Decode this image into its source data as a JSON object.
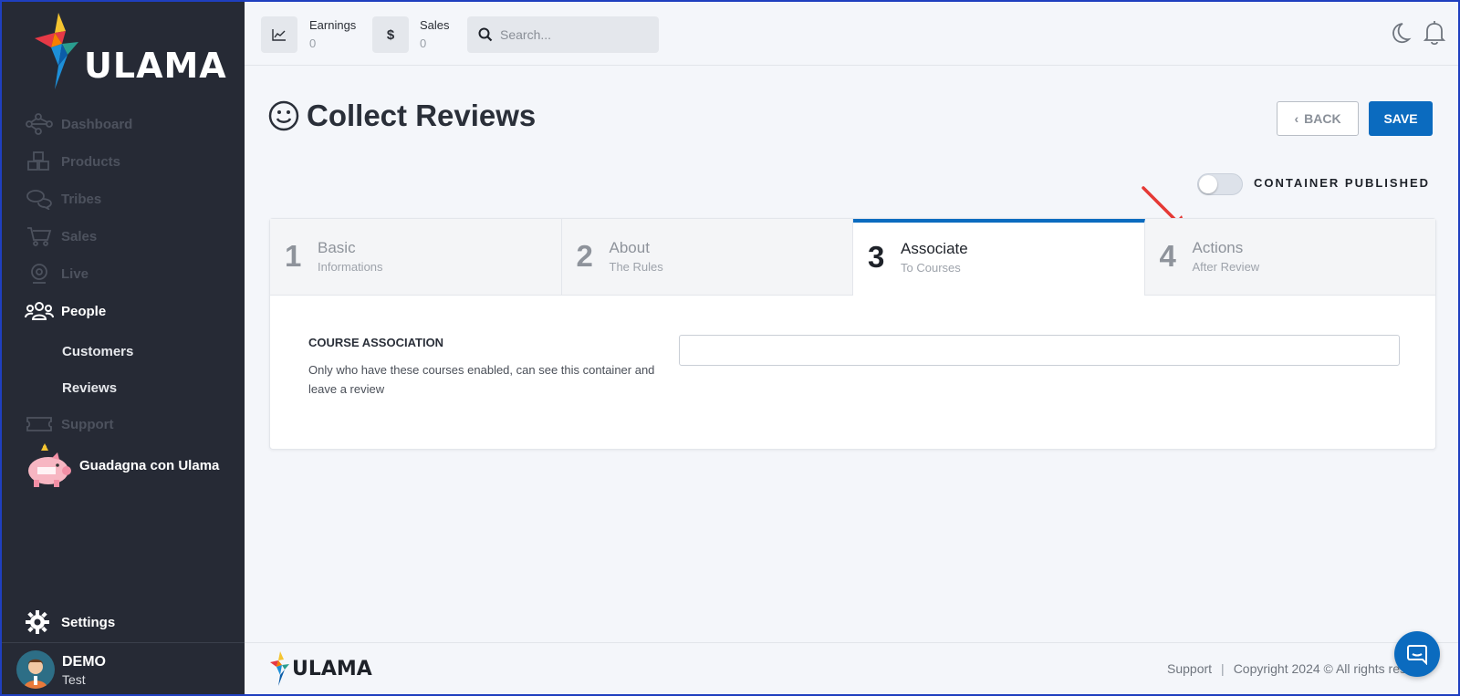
{
  "brand": {
    "name": "ULAMA"
  },
  "sidebar": {
    "items": [
      {
        "label": "Dashboard",
        "icon": "network-icon"
      },
      {
        "label": "Products",
        "icon": "cubes-icon"
      },
      {
        "label": "Tribes",
        "icon": "chat-bubbles-icon"
      },
      {
        "label": "Sales",
        "icon": "cart-icon"
      },
      {
        "label": "Live",
        "icon": "webcam-icon"
      },
      {
        "label": "People",
        "icon": "people-icon"
      },
      {
        "label": "Support",
        "icon": "ticket-icon"
      }
    ],
    "sub_items": [
      {
        "label": "Customers"
      },
      {
        "label": "Reviews"
      }
    ],
    "promo": {
      "label": "Guadagna con Ulama"
    },
    "settings": {
      "label": "Settings"
    },
    "user": {
      "name": "DEMO",
      "sub": "Test"
    }
  },
  "topbar": {
    "earnings": {
      "label": "Earnings",
      "value": "0"
    },
    "sales": {
      "label": "Sales",
      "value": "0"
    },
    "search": {
      "placeholder": "Search..."
    }
  },
  "page": {
    "title": "Collect Reviews",
    "back_label": "BACK",
    "save_label": "SAVE",
    "toggle_label": "CONTAINER PUBLISHED",
    "toggle_on": false
  },
  "steps": [
    {
      "num": "1",
      "title": "Basic",
      "sub": "Informations",
      "active": false
    },
    {
      "num": "2",
      "title": "About",
      "sub": "The Rules",
      "active": false
    },
    {
      "num": "3",
      "title": "Associate",
      "sub": "To Courses",
      "active": true
    },
    {
      "num": "4",
      "title": "Actions",
      "sub": "After Review",
      "active": false
    }
  ],
  "form": {
    "label": "COURSE ASSOCIATION",
    "help": "Only who have these courses enabled, can see this container and leave a review",
    "value": ""
  },
  "footer": {
    "support": "Support",
    "copyright": "Copyright 2024 © All rights res"
  },
  "colors": {
    "accent": "#0b6bbf",
    "sidebar": "#262a35",
    "annotation_arrow": "#e53935"
  }
}
